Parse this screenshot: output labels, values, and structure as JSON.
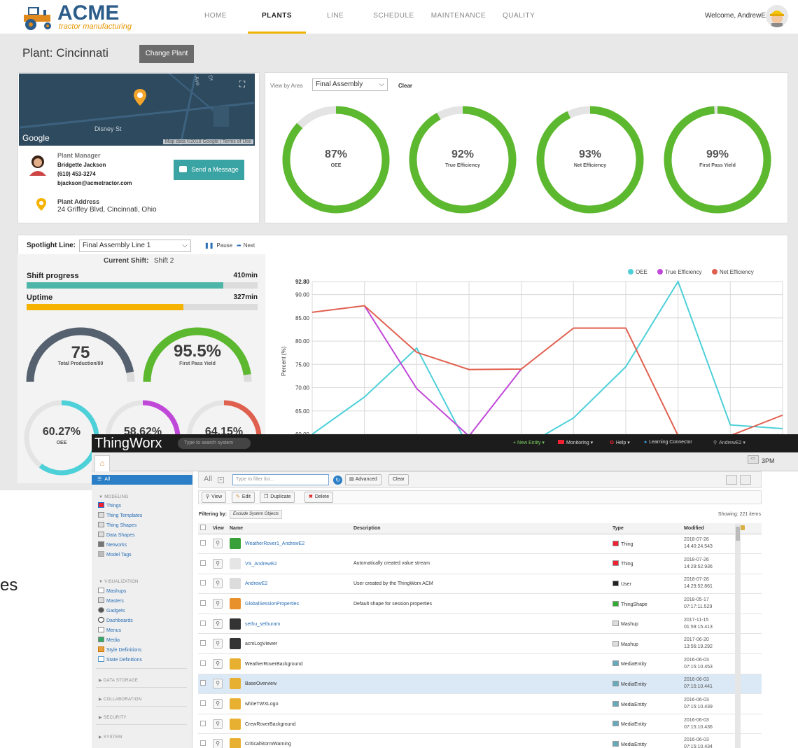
{
  "app": {
    "logo_title": "ACME",
    "logo_sub": "tractor manufacturing",
    "nav": [
      "HOME",
      "PLANTS",
      "LINE",
      "SCHEDULE",
      "MAINTENANCE",
      "QUALITY"
    ],
    "nav_active": "PLANTS",
    "welcome": "Welcome, AndrewE"
  },
  "plant": {
    "title": "Plant: Cincinnati",
    "change_label": "Change Plant"
  },
  "map": {
    "google": "Google",
    "data_text": "Map data ©2018 Google | Terms of Use",
    "street": "Disney St",
    "label_dr": "Dr",
    "label_ave": "Ave"
  },
  "manager": {
    "label": "Plant Manager",
    "name": "Bridgette Jackson",
    "phone": "(610) 453-3274",
    "email": "bjackson@acmetractor.com",
    "send_label": "Send a Message",
    "address_label": "Plant Address",
    "address": "24 Griffey Blvd, Cincinnati, Ohio"
  },
  "area": {
    "view_label": "View by Area",
    "selected": "Final Assembly",
    "clear_label": "Clear",
    "gauges": [
      {
        "value": "87%",
        "label": "OEE",
        "pct": 87
      },
      {
        "value": "92%",
        "label": "True Efficiency",
        "pct": 92
      },
      {
        "value": "93%",
        "label": "Net Efficiency",
        "pct": 93
      },
      {
        "value": "99%",
        "label": "First Pass Yield",
        "pct": 99
      }
    ]
  },
  "spotlight": {
    "label": "Spotlight Line:",
    "selected": "Final Assembly Line 1",
    "pause_label": "Pause",
    "next_label": "Next",
    "shift_label": "Current Shift:",
    "shift_value": "Shift 2",
    "shift_progress_label": "Shift progress",
    "shift_progress_value": "410min",
    "shift_progress_fill": 0.85,
    "uptime_label": "Uptime",
    "uptime_value": "327min",
    "uptime_fill": 0.68,
    "production_value": "75",
    "production_label": "Total Production/80",
    "production_fill": 0.94,
    "fpy_value": "95.5%",
    "fpy_label": "First Pass Yield",
    "fpy_fill": 0.955,
    "oee_small_value": "60.27%",
    "oee_small_label": "OEE",
    "true_small_value": "58.62%",
    "net_small_value": "64.15%",
    "colors": {
      "oee": "#4dd0d8",
      "true": "#c048d8",
      "net": "#e06050"
    }
  },
  "chart_data": {
    "type": "line",
    "xlabel": "",
    "ylabel": "Percent (%)",
    "ylim": [
      60,
      92.8
    ],
    "yticks": [
      "92.80",
      "90.00",
      "85.00",
      "80.00",
      "75.00",
      "70.00",
      "65.00",
      "60.00"
    ],
    "x_partial_tick": "3PM",
    "series": [
      {
        "name": "OEE",
        "color": "#4dd0d8",
        "values": [
          60,
          68,
          78.5,
          57,
          57,
          63.5,
          74.5,
          92.8,
          62,
          61.2
        ]
      },
      {
        "name": "True Efficiency",
        "color": "#c048d8",
        "values": [
          null,
          87.6,
          69.8,
          59.6,
          74,
          null,
          null,
          null,
          null,
          null
        ]
      },
      {
        "name": "Net Efficiency",
        "color": "#e06050",
        "values": [
          86.2,
          87.6,
          77.6,
          73.9,
          74,
          82.8,
          82.8,
          59.7,
          59.7,
          64.1
        ]
      }
    ]
  },
  "thingworx": {
    "logo": "ThingWorx",
    "search_placeholder": "Type to search system",
    "menu": [
      "+ New Entity ▾",
      "Monitoring ▾",
      "Help ▾",
      "Learning Connector",
      "AndrewE2 ▾"
    ],
    "side_all": "All",
    "sections": {
      "modeling": "MODELING",
      "visualization": "VISUALIZATION",
      "data_storage": "DATA STORAGE",
      "collaboration": "COLLABORATION",
      "security": "SECURITY",
      "system": "SYSTEM"
    },
    "modeling_items": [
      "Things",
      "Thing Templates",
      "Thing Shapes",
      "Data Shapes",
      "Networks",
      "Model Tags"
    ],
    "visualization_items": [
      "Mashups",
      "Masters",
      "Gadgets",
      "Dashboards",
      "Menus",
      "Media",
      "Style Definitions",
      "State Definitions"
    ],
    "all_label": "All",
    "filter_placeholder": "Type to filter list...",
    "advanced_label": "Advanced",
    "clear_label": "Clear",
    "actions": {
      "view": "View",
      "edit": "Edit",
      "duplicate": "Duplicate",
      "delete": "Delete"
    },
    "filtering_by": "Filtering by:",
    "filtering_value": "Exclude System Objects",
    "showing": "Showing: 221 items",
    "columns": {
      "view": "View",
      "name": "Name",
      "description": "Description",
      "type": "Type",
      "modified": "Modified"
    },
    "rows": [
      {
        "name": "WeatherRover1_AndrewE2",
        "desc": "",
        "type": "Thing",
        "date": "2018-07-26",
        "time": "14:40:24.543",
        "link": true
      },
      {
        "name": "VS_AndrewE2",
        "desc": "Automatically created value stream",
        "type": "Thing",
        "date": "2018-07-26",
        "time": "14:29:52.936",
        "link": true
      },
      {
        "name": "AndrewE2",
        "desc": "User created by the ThingWorx ACM",
        "type": "User",
        "date": "2018-07-26",
        "time": "14:29:52.861",
        "link": true
      },
      {
        "name": "GlobalSessionProperties",
        "desc": "Default shape for session properties",
        "type": "ThingShape",
        "date": "2018-05-17",
        "time": "07:17:11.529",
        "link": true
      },
      {
        "name": "sethu_sethuram",
        "desc": "",
        "type": "Mashup",
        "date": "2017-11-15",
        "time": "01:59:15.413",
        "link": true
      },
      {
        "name": "acmLogViewer",
        "desc": "",
        "type": "Mashup",
        "date": "2017-06-20",
        "time": "13:56:19.292",
        "link": false
      },
      {
        "name": "WeatherRoverBackground",
        "desc": "",
        "type": "MediaEntity",
        "date": "2016-06-03",
        "time": "07:15:10.453",
        "link": false
      },
      {
        "name": "BaseOverview",
        "desc": "",
        "type": "MediaEntity",
        "date": "2016-06-03",
        "time": "07:15:10.441",
        "link": false
      },
      {
        "name": "whiteTWXLogo",
        "desc": "",
        "type": "MediaEntity",
        "date": "2016-06-03",
        "time": "07:15:10.439",
        "link": false
      },
      {
        "name": "CrewRoverBackground",
        "desc": "",
        "type": "MediaEntity",
        "date": "2016-06-03",
        "time": "07:15:10.436",
        "link": false
      },
      {
        "name": "CriticalStormWarning",
        "desc": "",
        "type": "MediaEntity",
        "date": "2016-06-03",
        "time": "07:15:10.434",
        "link": false
      }
    ],
    "selected_row": 7
  },
  "fragment": {
    "text": "es"
  }
}
